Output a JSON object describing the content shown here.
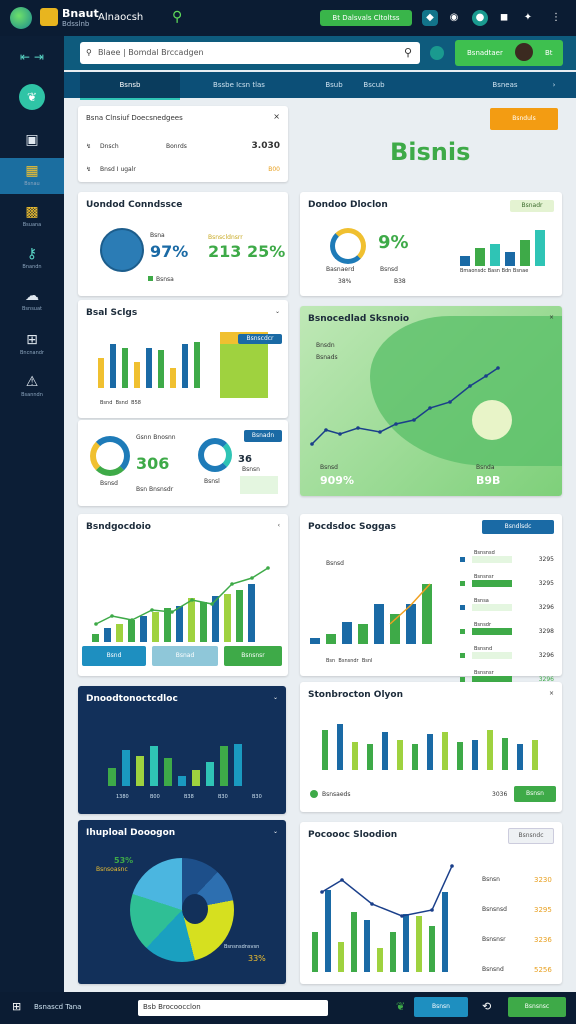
{
  "topbar": {
    "app_name": "Bnaut",
    "app_sub": "Bdsslnb",
    "app_name2": "Alnaocsh",
    "pill": "Bt Dalsvals Cltoltss",
    "colors": {
      "accent": "#39b54a",
      "brand": "#e8b51f",
      "bg": "#0b1c33"
    }
  },
  "sidebar": {
    "items": [
      {
        "icon": "leaf-icon",
        "label": ""
      },
      {
        "icon": "clipboard-icon",
        "label": ""
      },
      {
        "icon": "grid-icon",
        "label": "Bsnau"
      },
      {
        "icon": "wallet-icon",
        "label": "Bsuana"
      },
      {
        "icon": "key-icon",
        "label": "Bnandn"
      },
      {
        "icon": "cloud-icon",
        "label": "Bsnsuat"
      },
      {
        "icon": "table-icon",
        "label": "Bncnandr"
      },
      {
        "icon": "warning-icon",
        "label": "Bsanndn"
      }
    ]
  },
  "header": {
    "search_placeholder": "Blaee | Bomdal Brccadgen",
    "user_label": "Bsnadtaer",
    "user_extra": "Bt"
  },
  "tabs": [
    "Bsnsb",
    "Bssbe Icsn tlas",
    "Bsub",
    "Bscub",
    "Bsneas"
  ],
  "info_card": {
    "title": "Bsna Clnsiuf Doecsnedgees",
    "row1_label": "Dnsch",
    "row1_mid": "Bonrds",
    "row1_value": "3.030",
    "row2_label": "Bnsd I ugalr",
    "row2_value": "B00"
  },
  "action_button": "Bsnduls",
  "brand_title": "Bisnis",
  "kpi_card_left": {
    "title": "Uondod Conndssce",
    "value1": "97%",
    "value1_label": "Bsna",
    "value2": "213 25%",
    "value2_label": "Bsnscldnsrr",
    "legend": "Bsnsa"
  },
  "kpi_card_right": {
    "title": "Dondoo Dloclon",
    "value": "9%",
    "label1": "Basnaerd",
    "label2": "Bsnsd",
    "sub1": "38%",
    "sub2": "B38",
    "button": "Bsnadr",
    "footer": "Bmaonsdc Basn Bdn Bsnae"
  },
  "bar_card": {
    "title": "Bsal Sclgs",
    "button": "Bsnscdcr",
    "legend": [
      "Bsnd",
      "Bsnd",
      "B58"
    ]
  },
  "donut_card": {
    "title": "Gsnn Bnosnn",
    "button": "Bsnadn",
    "value": "306",
    "value2": "36",
    "value2_label": "Bsnsn",
    "l1": "Bsnsd",
    "l2": "Bsnsl",
    "l3": "Bsn Bnsnsdr"
  },
  "map_card": {
    "title": "Bsnocedlad Sksnoio",
    "label": "Bnsdn",
    "label2": "Bsnads",
    "left_value": "909%",
    "left_label": "Bsnsd",
    "right_value": "B9B",
    "right_label": "Bsnda"
  },
  "line_card": {
    "title": "Bsndgocdoio",
    "buttons": [
      "Bsnd",
      "Bsnad",
      "Bsnsnsr"
    ]
  },
  "combo_card": {
    "title": "Pocdsdoc Soggas",
    "button": "Bsndlsdc",
    "y_label": "Bsnsd",
    "legend": [
      "Bsn",
      "Bsnsndr",
      "Bsnl"
    ],
    "rows": [
      {
        "label": "Bsnsnsd",
        "value": "3295"
      },
      {
        "label": "Bsnsnsr",
        "value": "3295"
      },
      {
        "label": "Bsnsa",
        "value": "3296"
      },
      {
        "label": "Bsnsdr",
        "value": "3298"
      },
      {
        "label": "Bsnsnd",
        "value": "3296"
      },
      {
        "label": "Bsnsnsr",
        "value": "3296"
      }
    ]
  },
  "dark_bar_card": {
    "title": "Dnoodtonoctcdloc",
    "ticks": [
      "1380",
      "B00",
      "B38",
      "B30",
      "B30"
    ]
  },
  "station_card": {
    "title": "Stonbrocton Olyon",
    "label": "Bsnsaeds",
    "value": "3036",
    "button": "Bsnsn"
  },
  "pie_card": {
    "title": "Ihuploal Dooogon",
    "value": "53%",
    "value_label": "Bsnsoasnc",
    "label": "Bsnsnsdnsvsn",
    "value2": "33%"
  },
  "bottom_card": {
    "title": "Pocoooc Sloodion",
    "button": "Bsnsndc",
    "rows": [
      {
        "label": "Bsnsn",
        "value": "3230"
      },
      {
        "label": "Bsnsnsd",
        "value": "3295"
      },
      {
        "label": "Bsnsnsr",
        "value": "3236"
      },
      {
        "label": "Bsnsnd",
        "value": "5256"
      }
    ]
  },
  "footer": {
    "label": "Bsnascd Tana",
    "label2": "Bsb Brocoocclon",
    "btn1": "Bsnsn",
    "btn2": "Bsnsnsc"
  }
}
